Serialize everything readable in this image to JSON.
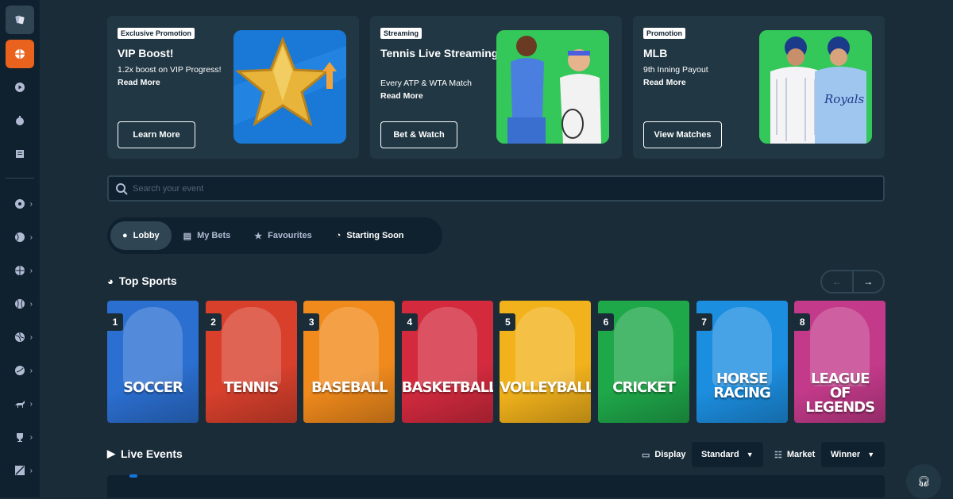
{
  "sidebar": {
    "icons": [
      "soccer-icon",
      "tennis-icon",
      "basketball-icon",
      "baseball-icon",
      "volleyball-icon",
      "cricket-icon",
      "horse-racing-icon",
      "trophy-icon",
      "esports-icon"
    ]
  },
  "promos": [
    {
      "tag": "Exclusive Promotion",
      "title": "VIP Boost!",
      "desc_text": "1.2x boost on VIP Progress!",
      "desc_link": "Read More",
      "button": "Learn More"
    },
    {
      "tag": "Streaming",
      "title": "Tennis Live Streaming",
      "desc_text": "Every ATP & WTA Match",
      "desc_link": "Read More",
      "button": "Bet & Watch"
    },
    {
      "tag": "Promotion",
      "title": "MLB",
      "desc_text": "9th Inning Payout",
      "desc_link": "Read More",
      "button": "View Matches"
    }
  ],
  "search": {
    "placeholder": "Search your event"
  },
  "tabs": [
    {
      "label": "Lobby",
      "icon": "lobby-icon"
    },
    {
      "label": "My Bets",
      "icon": "betslip-icon"
    },
    {
      "label": "Favourites",
      "icon": "star-icon"
    },
    {
      "label": "Starting Soon",
      "icon": "stopwatch-icon"
    }
  ],
  "top_sports": {
    "title": "Top Sports",
    "cards": [
      {
        "rank": "1",
        "name": "SOCCER",
        "color": "#2b6fd1"
      },
      {
        "rank": "2",
        "name": "TENNIS",
        "color": "#d8402c"
      },
      {
        "rank": "3",
        "name": "BASEBALL",
        "color": "#f08a1c"
      },
      {
        "rank": "4",
        "name": "BASKETBALL",
        "color": "#d32a3e"
      },
      {
        "rank": "5",
        "name": "VOLLEYBALL",
        "color": "#f2b21b"
      },
      {
        "rank": "6",
        "name": "CRICKET",
        "color": "#1fa84a"
      },
      {
        "rank": "7",
        "name": "HORSE RACING",
        "color": "#1c8ee0"
      },
      {
        "rank": "8",
        "name": "LEAGUE OF LEGENDS",
        "color": "#c33a8a"
      }
    ]
  },
  "live": {
    "title": "Live Events",
    "display_label": "Display",
    "display_value": "Standard",
    "market_label": "Market",
    "market_value": "Winner"
  }
}
